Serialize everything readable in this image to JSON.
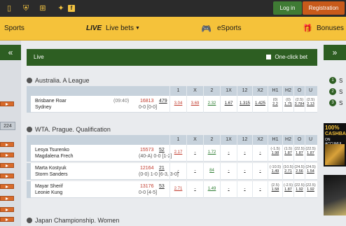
{
  "topbar": {
    "login_label": "Log in",
    "register_label": "Registration"
  },
  "nav": {
    "sports": "Sports",
    "live_prefix": "LIVE",
    "live_bets": "Live bets",
    "esports": "eSports",
    "bonuses": "Bonuses"
  },
  "left": {
    "badge": "224"
  },
  "live": {
    "title": "Live",
    "one_click": "One-click bet"
  },
  "columns": [
    "1",
    "X",
    "2",
    "1X",
    "12",
    "X2",
    "H1",
    "H2",
    "O",
    "U"
  ],
  "leagues": [
    {
      "name": "Australia. A League",
      "icon": "football-icon",
      "matches": [
        {
          "team1": "Brisbane Roar",
          "team2": "Sydney",
          "time": "(09:40)",
          "id": "16813",
          "count": "479",
          "score": "0-0 [0-0]",
          "odds": [
            "3.04",
            "3.69",
            "2.32",
            "1.67",
            "1.315",
            "1.425"
          ],
          "handicaps": [
            [
              "(0)",
              "2.2"
            ],
            [
              "(0)",
              "1.75"
            ],
            [
              "(2.5)",
              "3.784"
            ],
            [
              "(2.5)",
              "2.13"
            ]
          ]
        }
      ]
    },
    {
      "name": "WTA. Prague. Qualification",
      "icon": "tennis-ball-icon",
      "matches": [
        {
          "team1": "Lesya Tsurenko",
          "team2": "Magdalena Frech",
          "time": "",
          "id": "15573",
          "count": "52",
          "score": "(40-A) 0-0 [1-2]",
          "odds": [
            "2.17",
            "-",
            "1.72",
            "-",
            "-",
            "-"
          ],
          "handicaps": [
            [
              "(-1.5)",
              "1.98"
            ],
            [
              "(1.5)",
              "1.87"
            ],
            [
              "(22.5)",
              "1.87"
            ],
            [
              "(22.5)",
              "1.87"
            ]
          ]
        },
        {
          "team1": "Marta Kostyuk",
          "team2": "Storm Sanders",
          "time": "",
          "id": "12164",
          "count": "21",
          "score": "(0-0) 1-0 [6-3, 3-0]",
          "odds": [
            "-",
            "-",
            "84",
            "-",
            "-",
            "-"
          ],
          "handicaps": [
            [
              "(-10.5)",
              "1.49"
            ],
            [
              "(10.5)",
              "2.71"
            ],
            [
              "(24.5)",
              "2.56"
            ],
            [
              "(24.5)",
              "1.54"
            ]
          ]
        },
        {
          "team1": "Mayar Sherif",
          "team2": "Leonie Kung",
          "time": "",
          "id": "13176",
          "count": "53",
          "score": "0-0 [4-5]",
          "odds": [
            "2.71",
            "-",
            "1.49",
            "-",
            "-",
            "-"
          ],
          "handicaps": [
            [
              "(2.5)",
              "1.58"
            ],
            [
              "(-2.5)",
              "1.87"
            ],
            [
              "(22.5)",
              "1.92"
            ],
            [
              "(22.5)",
              "1.92"
            ]
          ]
        }
      ]
    },
    {
      "name": "Japan Championship. Women",
      "icon": "volleyball-icon",
      "matches": []
    }
  ],
  "right": {
    "steps": [
      "1",
      "2",
      "3"
    ],
    "labels": [
      "S",
      "S",
      "S"
    ]
  },
  "promo": {
    "line1": "100%",
    "line2": "CASHBA",
    "line3": "ON ACCUMUL"
  },
  "colors": {
    "header_dark": "#2b2b2b",
    "accent_yellow": "#f5c23a",
    "live_green": "#2d5e22",
    "login_green": "#3f7b34",
    "register_orange": "#c85a1a"
  }
}
